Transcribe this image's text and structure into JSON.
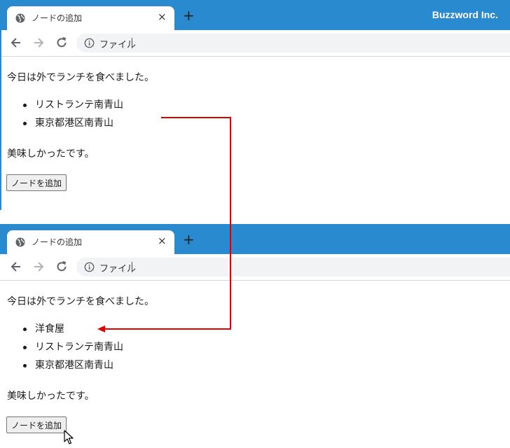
{
  "colors": {
    "titlebar": "#2a8ad0",
    "annotation_arrow": "#e00000",
    "button_bg": "#efefef"
  },
  "brand": "Buzzword Inc.",
  "before": {
    "tab": {
      "title": "ノードの追加",
      "close": "×",
      "new_tab": "+"
    },
    "toolbar": {
      "address_label": "ファイル"
    },
    "page": {
      "intro": "今日は外でランチを食べました。",
      "items": [
        "リストランテ南青山",
        "東京都港区南青山"
      ],
      "outro": "美味しかったです。",
      "button": "ノードを追加"
    }
  },
  "after": {
    "tab": {
      "title": "ノードの追加",
      "close": "×",
      "new_tab": "+"
    },
    "toolbar": {
      "address_label": "ファイル"
    },
    "page": {
      "intro": "今日は外でランチを食べました。",
      "items": [
        "洋食屋",
        "リストランテ南青山",
        "東京都港区南青山"
      ],
      "outro": "美味しかったです。",
      "button": "ノードを追加"
    }
  },
  "icons": {
    "tab": "globe-icon",
    "nav": [
      "back-arrow-icon",
      "forward-arrow-icon",
      "reload-icon"
    ],
    "address": "info-icon",
    "pointer": "mouse-cursor-icon"
  }
}
